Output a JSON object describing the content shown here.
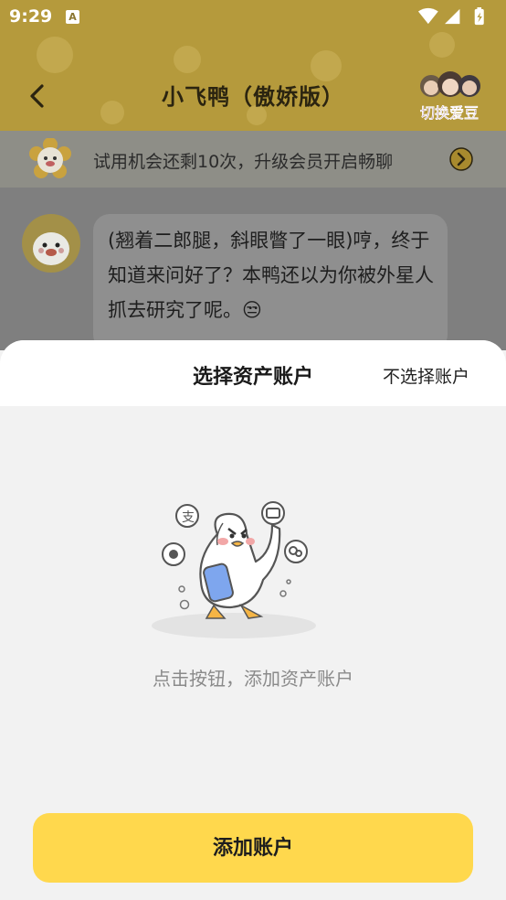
{
  "status_bar": {
    "time": "9:29",
    "notification_badge": "A"
  },
  "nav": {
    "title": "小飞鸭（傲娇版）",
    "switch_idol_label": "切换爱豆"
  },
  "trial_banner": {
    "text": "试用机会还剩10次，升级会员开启畅聊"
  },
  "chat": {
    "messages": [
      {
        "text": "(翘着二郎腿，斜眼瞥了一眼)哼，终于知道来问好了？本鸭还以为你被外星人抓去研究了呢。😒"
      }
    ]
  },
  "sheet": {
    "title": "选择资产账户",
    "skip_label": "不选择账户",
    "empty_text": "点击按钮，添加资产账户",
    "add_button_label": "添加账户"
  },
  "colors": {
    "accent": "#ffd84d",
    "overlay_header": "#b59a3c",
    "sheet_background": "#f2f2f2"
  },
  "icons": [
    "back-arrow-icon",
    "wifi-icon",
    "signal-icon",
    "battery-icon",
    "chevron-right-icon",
    "duck-mascot-icon"
  ]
}
